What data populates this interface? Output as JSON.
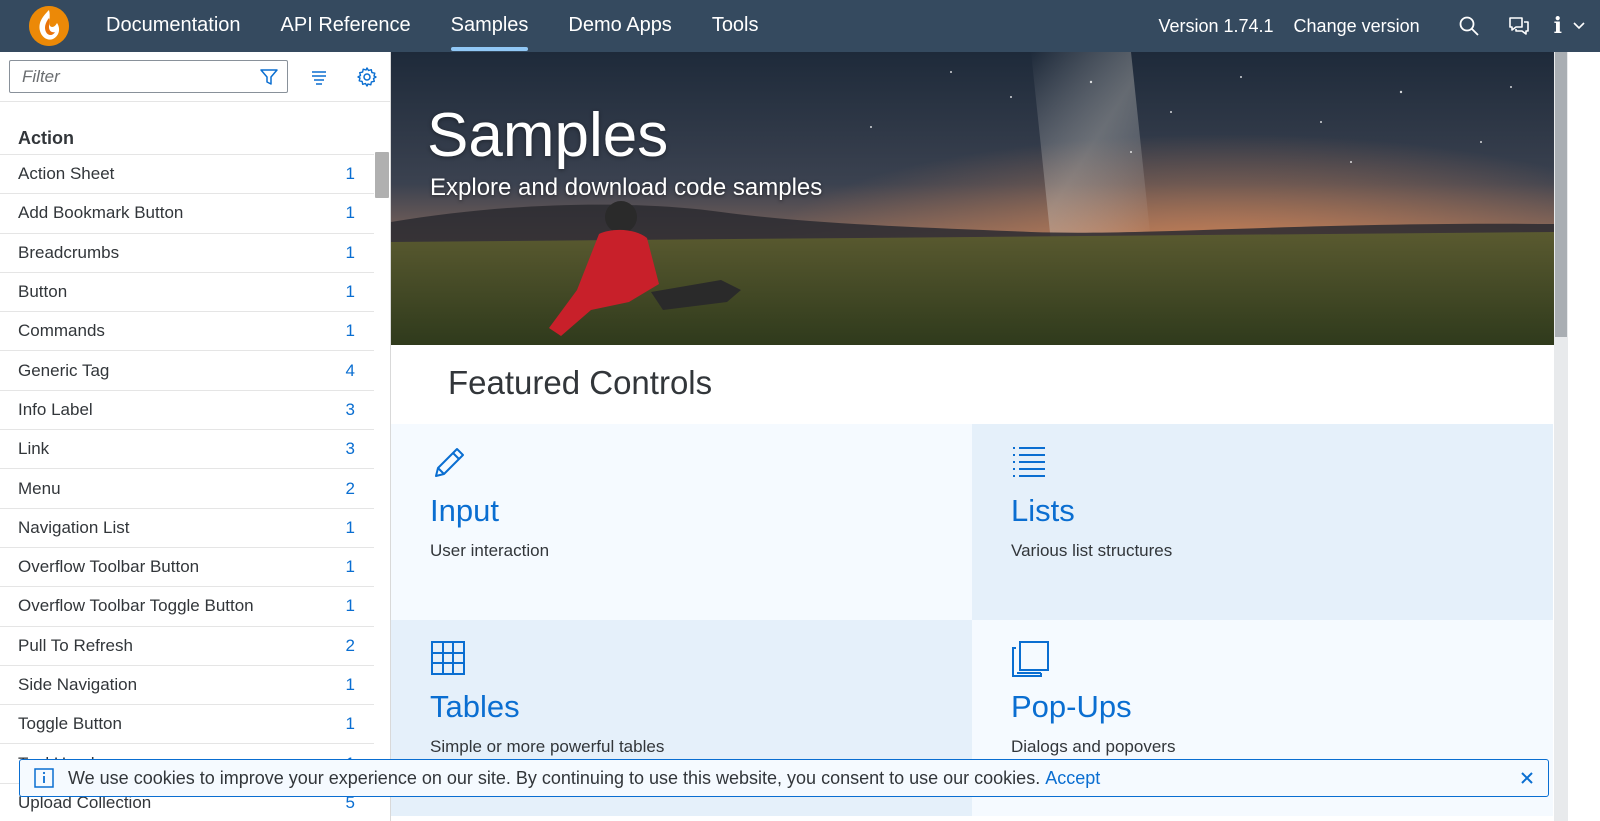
{
  "header": {
    "nav": [
      "Documentation",
      "API Reference",
      "Samples",
      "Demo Apps",
      "Tools"
    ],
    "active_nav": "Samples",
    "version_label": "Version 1.74.1",
    "change_version_label": "Change version",
    "icons": [
      "search-icon",
      "feedback-icon",
      "info-icon",
      "chevron-down-icon"
    ]
  },
  "sidebar": {
    "filter_placeholder": "Filter",
    "group_title": "Action",
    "items": [
      {
        "label": "Action Sheet",
        "count": "1"
      },
      {
        "label": "Add Bookmark Button",
        "count": "1"
      },
      {
        "label": "Breadcrumbs",
        "count": "1"
      },
      {
        "label": "Button",
        "count": "1"
      },
      {
        "label": "Commands",
        "count": "1"
      },
      {
        "label": "Generic Tag",
        "count": "4"
      },
      {
        "label": "Info Label",
        "count": "3"
      },
      {
        "label": "Link",
        "count": "3"
      },
      {
        "label": "Menu",
        "count": "2"
      },
      {
        "label": "Navigation List",
        "count": "1"
      },
      {
        "label": "Overflow Toolbar Button",
        "count": "1"
      },
      {
        "label": "Overflow Toolbar Toggle Button",
        "count": "1"
      },
      {
        "label": "Pull To Refresh",
        "count": "2"
      },
      {
        "label": "Side Navigation",
        "count": "1"
      },
      {
        "label": "Toggle Button",
        "count": "1"
      },
      {
        "label": "Tool Header",
        "count": "1"
      },
      {
        "label": "Upload Collection",
        "count": "5"
      }
    ]
  },
  "hero": {
    "title": "Samples",
    "subtitle": "Explore and download code samples"
  },
  "featured": {
    "title": "Featured Controls",
    "tiles": [
      {
        "title": "Input",
        "desc": "User interaction",
        "icon": "edit-icon"
      },
      {
        "title": "Lists",
        "desc": "Various list structures",
        "icon": "list-icon"
      },
      {
        "title": "Tables",
        "desc": "Simple or more powerful tables",
        "icon": "table-icon"
      },
      {
        "title": "Pop-Ups",
        "desc": "Dialogs and popovers",
        "icon": "popup-icon"
      }
    ]
  },
  "cookie": {
    "text": "We use cookies to improve your experience on our site. By continuing to use this website, you consent to use our cookies.",
    "accept_label": "Accept"
  },
  "colors": {
    "shell": "#354a5f",
    "accent": "#0a6ed1",
    "tile_light": "#f5faff",
    "tile_medium": "#e5f0fa"
  }
}
